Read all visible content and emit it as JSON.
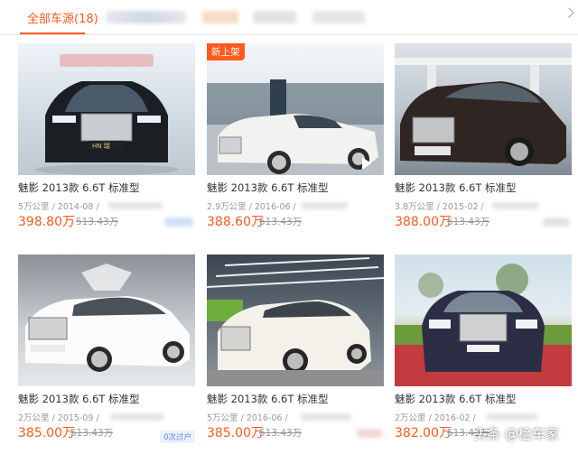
{
  "tabs": {
    "active_label": "全部车源(18)"
  },
  "colors": {
    "accent": "#ff5a1f",
    "price": "#ff5a1f",
    "muted": "#999999"
  },
  "cards": [
    {
      "title": "魅影 2013款 6.6T 标准型",
      "meta": "5万公里 / 2014-08 /",
      "price": "398.80万",
      "original_price": "513.43万"
    },
    {
      "title": "魅影 2013款 6.6T 标准型",
      "meta": "2.9万公里 / 2016-06 /",
      "price": "388.60万",
      "original_price": "513.43万",
      "badge": "新上架",
      "icons": [
        "play-icon"
      ]
    },
    {
      "title": "魅影 2013款 6.6T 标准型",
      "meta": "3.8万公里 / 2015-02 /",
      "price": "388.00万",
      "original_price": "513.43万"
    },
    {
      "title": "魅影 2013款 6.6T 标准型",
      "meta": "2万公里 / 2015-09 /",
      "price": "385.00万",
      "original_price": "513.43万",
      "tag": "0次过户"
    },
    {
      "title": "魅影 2013款 6.6T 标准型",
      "meta": "5万公里 / 2016-06 /",
      "price": "385.00万",
      "original_price": "513.43万"
    },
    {
      "title": "魅影 2013款 6.6T 标准型",
      "meta": "2万公里 / 2016-02 /",
      "price": "382.00万",
      "original_price": "513.43万"
    }
  ],
  "watermark": "头条 @检车家",
  "nav_icons": [
    "chevron-right-icon"
  ]
}
